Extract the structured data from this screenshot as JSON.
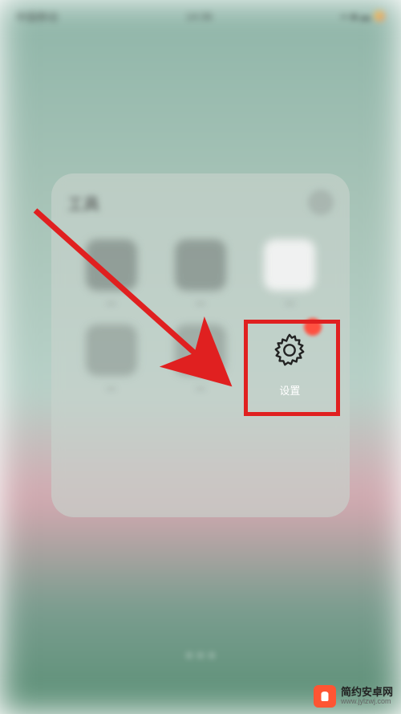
{
  "status": {
    "carrier": "中国移动",
    "time": "14:36"
  },
  "folder": {
    "title": "工具"
  },
  "apps": [
    {
      "label": "—"
    },
    {
      "label": "—"
    },
    {
      "label": "—"
    },
    {
      "label": "—"
    },
    {
      "label": "—"
    },
    {
      "label": "设置"
    }
  ],
  "highlighted_app": {
    "label": "设置",
    "icon_name": "gear-icon"
  },
  "watermark": {
    "title": "简约安卓网",
    "url": "www.jylzwj.com"
  }
}
